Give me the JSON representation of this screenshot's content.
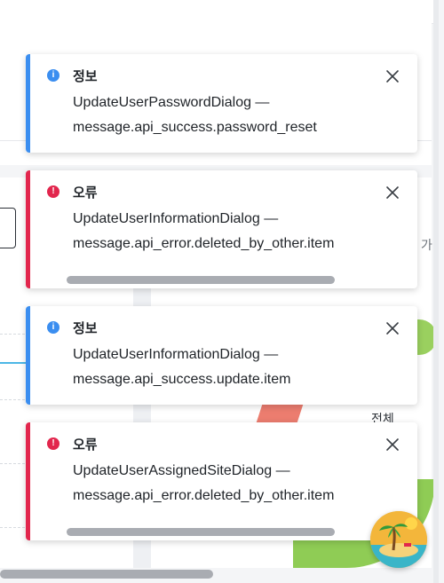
{
  "background": {
    "side_label_1": "가",
    "side_label_2": "전체"
  },
  "toasts": [
    {
      "type": "info",
      "title": "정보",
      "line1": "UpdateUserPasswordDialog —",
      "line2": "message.api_success.password_reset"
    },
    {
      "type": "error",
      "title": "오류",
      "line1": "UpdateUserInformationDialog —",
      "line2": "message.api_error.deleted_by_other.item"
    },
    {
      "type": "info",
      "title": "정보",
      "line1": "UpdateUserInformationDialog —",
      "line2": "message.api_success.update.item"
    },
    {
      "type": "error",
      "title": "오류",
      "line1": "UpdateUserAssignedSiteDialog —",
      "line2": "message.api_error.deleted_by_other.item"
    }
  ],
  "icons": {
    "info": "info-icon",
    "error": "error-icon",
    "close": "close-icon"
  },
  "colors": {
    "info_accent": "#3b8ef0",
    "error_accent": "#e2264d"
  }
}
